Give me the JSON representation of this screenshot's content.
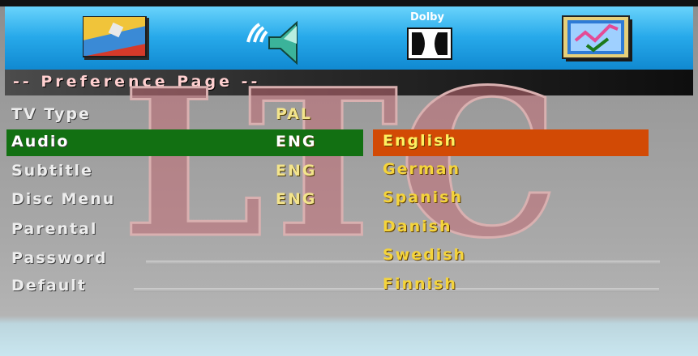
{
  "icon_bar": {
    "items": [
      {
        "name": "general-setup-icon"
      },
      {
        "name": "audio-setup-icon"
      },
      {
        "name": "dolby-setup-icon",
        "label": "Dolby"
      },
      {
        "name": "preference-setup-icon"
      }
    ]
  },
  "page_title": "-- Preference Page --",
  "watermark": "LTC",
  "menu": [
    {
      "label": "TV Type",
      "value": "PAL"
    },
    {
      "label": "Audio",
      "value": "ENG"
    },
    {
      "label": "Subtitle",
      "value": "ENG"
    },
    {
      "label": "Disc Menu",
      "value": "ENG"
    },
    {
      "label": "Parental",
      "value": ""
    },
    {
      "label": "Password",
      "value": ""
    },
    {
      "label": "Default",
      "value": ""
    }
  ],
  "options": [
    "English",
    "German",
    "Spanish",
    "Danish",
    "Swedish",
    "Finnish"
  ],
  "selected_option": "English",
  "colors": {
    "icon_bar": "#27a9ea",
    "selected_row": "#127012",
    "selected_option": "#d24a05",
    "option_text": "#f4d43c",
    "value_text": "#f3e48c"
  }
}
